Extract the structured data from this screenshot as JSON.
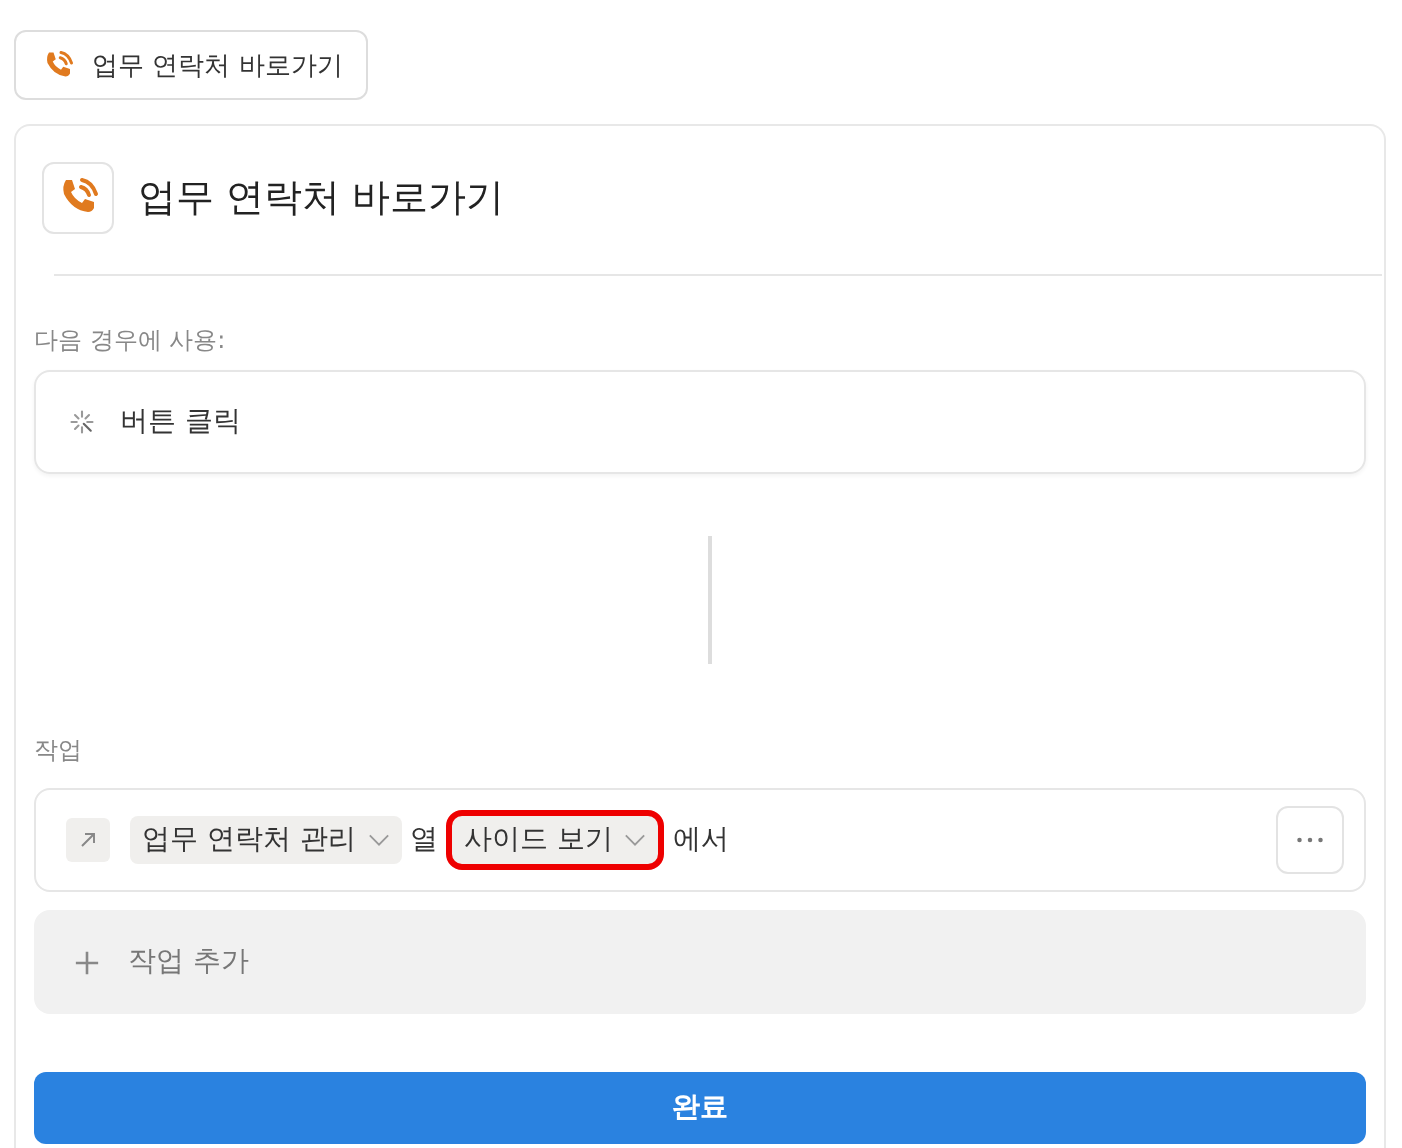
{
  "shortcut_chip": {
    "label": "업무 연락처 바로가기"
  },
  "card": {
    "title": "업무 연락처 바로가기",
    "trigger": {
      "label": "다음 경우에 사용:",
      "value": "버튼 클릭"
    },
    "actions_label": "작업",
    "actions": [
      {
        "target": "업무 연락처 관리",
        "verb": "열",
        "view": "사이드 보기",
        "view_highlighted": true,
        "suffix": "에서"
      }
    ],
    "add_action": "작업 추가",
    "done_button": "완료"
  }
}
